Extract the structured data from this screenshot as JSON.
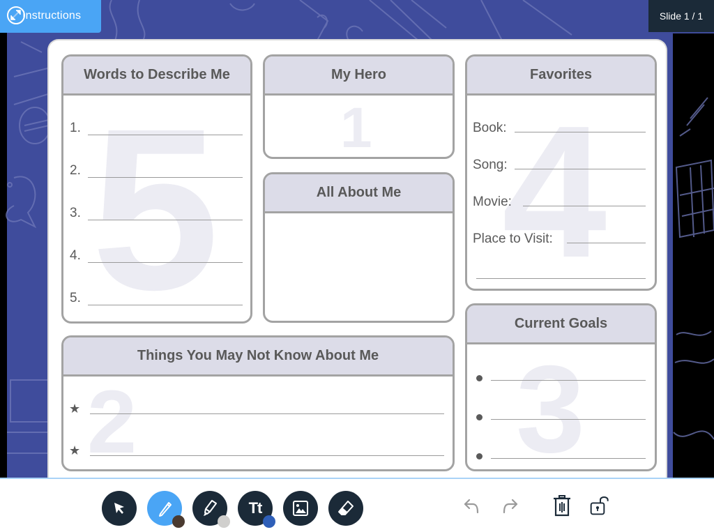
{
  "top_bar": {
    "instructions_label": "Instructions",
    "expand_icon": "expand-arrows-icon",
    "slide_counter": "Slide 1 / 1"
  },
  "slide": {
    "panels": {
      "words": {
        "title": "Words to Describe Me",
        "watermark": "5",
        "items": [
          "1.",
          "2.",
          "3.",
          "4.",
          "5."
        ]
      },
      "hero": {
        "title": "My Hero",
        "watermark": "1"
      },
      "about": {
        "title": "All About Me"
      },
      "favorites": {
        "title": "Favorites",
        "watermark": "4",
        "items": [
          "Book:",
          "Song:",
          "Movie:",
          "Place to Visit:"
        ]
      },
      "goals": {
        "title": "Current Goals",
        "watermark": "3",
        "bullet_icon": "bullet-dot-icon",
        "item_count": 3
      },
      "things": {
        "title": "Things You May Not Know About Me",
        "watermark": "2",
        "bullet_icon": "star-icon",
        "star_glyph": "★",
        "item_count": 2
      }
    }
  },
  "toolbar": {
    "tools": [
      {
        "name": "select",
        "icon": "cursor-arrow-icon",
        "active": false
      },
      {
        "name": "pen",
        "icon": "pencil-icon",
        "active": true,
        "color": "#4a3a30"
      },
      {
        "name": "highlighter",
        "icon": "highlighter-icon",
        "active": false,
        "color": "#d0cfcd"
      },
      {
        "name": "text",
        "icon": "text-tt-icon",
        "label": "Tt",
        "active": false,
        "color": "#2f5fb8"
      },
      {
        "name": "image",
        "icon": "image-icon",
        "active": false
      },
      {
        "name": "eraser",
        "icon": "eraser-icon",
        "active": false
      }
    ],
    "actions": [
      {
        "name": "undo",
        "icon": "undo-arrow-icon",
        "enabled": false
      },
      {
        "name": "redo",
        "icon": "redo-arrow-icon",
        "enabled": false
      },
      {
        "name": "delete",
        "icon": "trash-icon",
        "enabled": true
      },
      {
        "name": "lock",
        "icon": "unlocked-padlock-icon",
        "enabled": true
      }
    ]
  },
  "colors": {
    "stage_bg": "#3f4c9c",
    "instructions_bg": "#4aa5f5",
    "tool_bg": "#1b2a38",
    "active_tool_bg": "#4aa5f5",
    "panel_header_bg": "#dcdce8",
    "panel_border": "#a3a3a3",
    "toolbar_border": "#a9d3f7"
  }
}
